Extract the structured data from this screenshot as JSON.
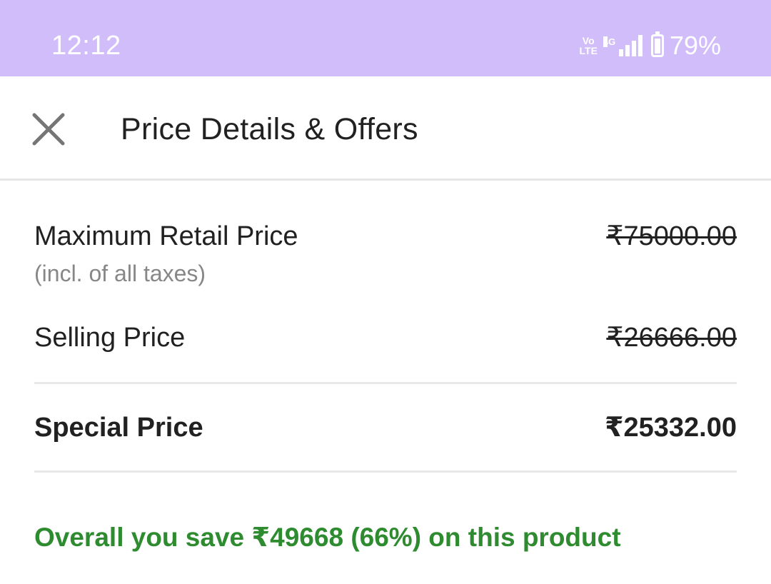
{
  "status_bar": {
    "time": "12:12",
    "volte_top": "Vo",
    "volte_bottom": "LTE",
    "network": "4G",
    "battery_percent": "79%",
    "battery_level": 0.79,
    "background_color": "#d2bdfb"
  },
  "header": {
    "close_icon": "close-icon",
    "title": "Price Details & Offers"
  },
  "price_rows": {
    "mrp": {
      "label": "Maximum Retail Price",
      "sublabel": "(incl. of all taxes)",
      "value": "₹75000.00",
      "strikethrough": true
    },
    "selling": {
      "label": "Selling Price",
      "value": "₹26666.00",
      "strikethrough": true
    },
    "special": {
      "label": "Special Price",
      "value": "₹25332.00",
      "strikethrough": false
    }
  },
  "savings": {
    "text": "Overall you save ₹49668 (66%) on this product",
    "color": "#2e8b2f"
  }
}
